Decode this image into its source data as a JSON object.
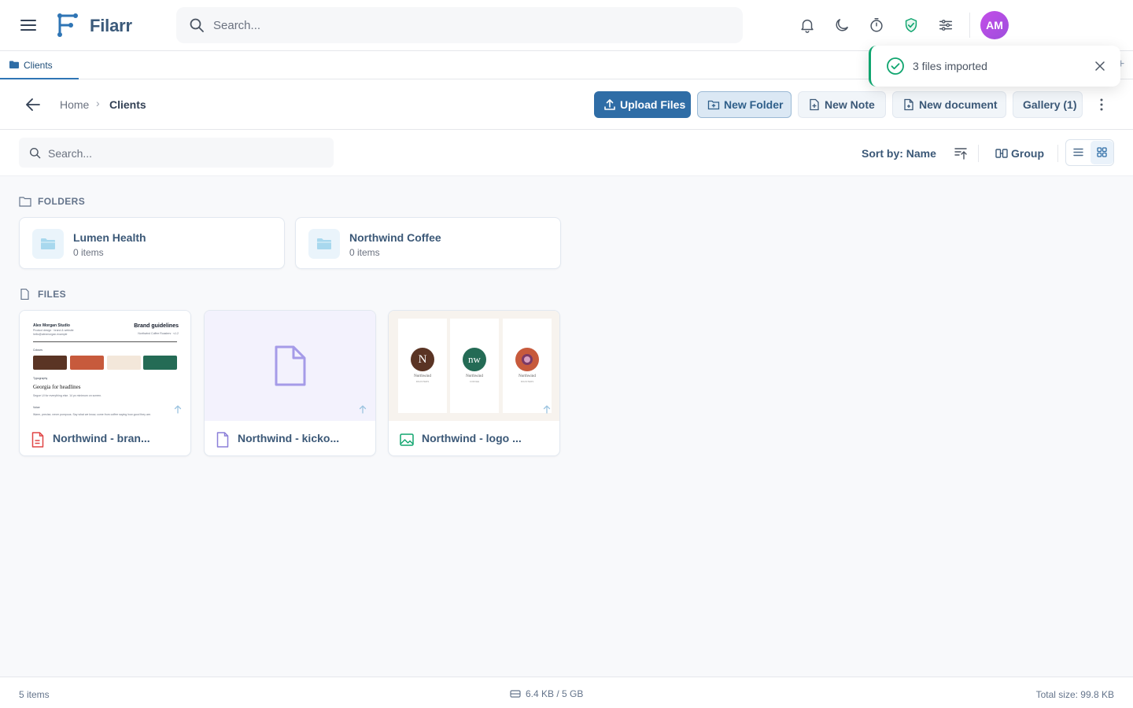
{
  "app": {
    "name": "Filarr",
    "search_placeholder": "Search...",
    "user_initials": "AM"
  },
  "tabs": [
    {
      "label": "Clients"
    }
  ],
  "breadcrumb": {
    "home": "Home",
    "current": "Clients"
  },
  "toolbar": {
    "upload_label": "Upload Files",
    "new_folder_label": "New Folder",
    "new_note_label": "New Note",
    "new_document_label": "New document",
    "gallery_label": "Gallery (1)"
  },
  "filter": {
    "search_placeholder": "Search...",
    "sort_label": "Sort by: Name",
    "group_label": "Group"
  },
  "sections": {
    "folders_title": "FOLDERS",
    "files_title": "FILES"
  },
  "folders": [
    {
      "name": "Lumen Health",
      "count": "0 items"
    },
    {
      "name": "Northwind Coffee",
      "count": "0 items"
    }
  ],
  "files": [
    {
      "name": "Northwind - bran...",
      "type": "pdf-icon"
    },
    {
      "name": "Northwind - kicko...",
      "type": "document-icon"
    },
    {
      "name": "Northwind - logo ...",
      "type": "image-icon"
    }
  ],
  "doc_preview": {
    "studio": "Alex Morgan Studio",
    "studio_info": "Product design · brand & website  hello@alexmorgan.example",
    "heading": "Brand guidelines",
    "subheading": "Northwind Coffee Roasters · v1.2",
    "colours_label": "Colours",
    "swatches": [
      "#5a3424",
      "#c75a3c",
      "#f3e7da",
      "#246b55"
    ],
    "typography_label": "Typography",
    "typography_example": "Georgia for headlines",
    "typography_note": "Segoe UI for everything else. 14 px minimum on screen.",
    "voice_label": "Voice",
    "voice_note": "Warm, precise, never pompous. Say what we know, come from coffee saying how good they are."
  },
  "logo_preview": [
    {
      "mark": "N",
      "color": "#5a3424",
      "name": "Northwind",
      "sub": "ROASTERS"
    },
    {
      "mark": "nw",
      "color": "#246b55",
      "name": "Northwind",
      "sub": "COFFEE"
    },
    {
      "mark": "",
      "color": "#c75a3c",
      "name": "Northwind",
      "sub": "ROASTERS"
    }
  ],
  "toast": {
    "message": "3 files imported"
  },
  "status": {
    "items": "5 items",
    "storage": "6.4 KB / 5 GB",
    "total": "Total size: 99.8 KB"
  },
  "colors": {
    "accent": "#2f6da6",
    "success": "#10a56f",
    "avatar": "#b44fe6"
  }
}
